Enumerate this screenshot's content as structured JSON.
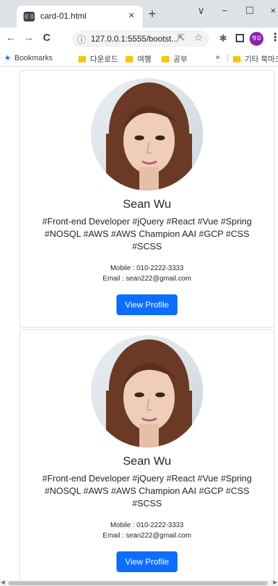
{
  "browser": {
    "tab_title": "card-01.html",
    "tab_close": "×",
    "new_tab": "+",
    "window_controls": {
      "chevron": "∨",
      "minimize": "−",
      "maximize": "☐",
      "close": "×"
    },
    "nav": {
      "back": "←",
      "forward": "→",
      "reload": "C"
    },
    "url": "127.0.0.1:5555/bootst...",
    "profile_label": "형섭",
    "bookmarks": [
      {
        "label": "Bookmarks"
      },
      {
        "label": "다운로드"
      },
      {
        "label": "여행"
      },
      {
        "label": "공부"
      }
    ],
    "bookmarks_overflow": "»",
    "other_bookmarks": "기타 북마크"
  },
  "cards": [
    {
      "name": "Sean Wu",
      "tags": "#Front-end Developer #jQuery #React #Vue #Spring #NOSQL #AWS #AWS Champion AAI #GCP #CSS #SCSS",
      "mobile": "Mobile : 010-2222-3333",
      "email": "Email : sean222@gmail.com",
      "button_label": "View Profile"
    },
    {
      "name": "Sean Wu",
      "tags": "#Front-end Developer #jQuery #React #Vue #Spring #NOSQL #AWS #AWS Champion AAI #GCP #CSS #SCSS",
      "mobile": "Mobile : 010-2222-3333",
      "email": "Email : sean222@gmail.com",
      "button_label": "View Profile"
    }
  ],
  "colors": {
    "button": "#0d6efd",
    "card_border": "#dcdfe3",
    "chrome_bg": "#dee1e6",
    "profile": "#8e24aa",
    "bookmark_folder": "#f9c50b"
  }
}
